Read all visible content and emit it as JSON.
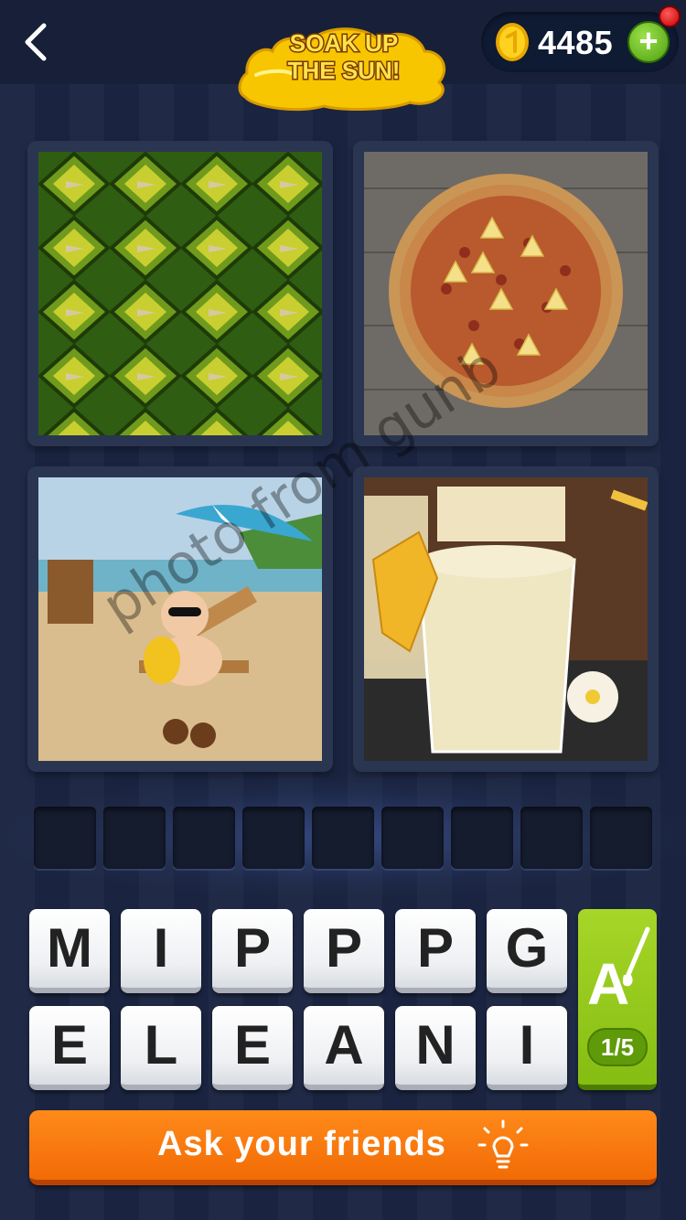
{
  "header": {
    "back_icon": "chevron-left-icon",
    "logo_text_line1": "SOAK UP",
    "logo_text_line2": "THE SUN!",
    "coins": "4485",
    "add_coins_label": "+",
    "coin_icon": "coin-icon"
  },
  "pictures": [
    {
      "subject": "pineapple skin close-up",
      "icon": "pineapple-skin-image"
    },
    {
      "subject": "pineapple pizza",
      "icon": "pizza-image"
    },
    {
      "subject": "baby on beach chair",
      "icon": "beach-baby-image"
    },
    {
      "subject": "pineapple smoothies",
      "icon": "smoothie-image"
    }
  ],
  "watermark": "photo from gunb",
  "answer_slots": [
    "",
    "",
    "",
    "",
    "",
    "",
    "",
    "",
    ""
  ],
  "keyboard": {
    "row1": [
      "M",
      "I",
      "P",
      "P",
      "P",
      "G"
    ],
    "row2": [
      "E",
      "L",
      "E",
      "A",
      "N",
      "I"
    ]
  },
  "hint": {
    "icon": "letter-brush-icon",
    "count": "1/5"
  },
  "ask_friends": {
    "label": "Ask your friends",
    "icon": "lightbulb-icon"
  },
  "colors": {
    "background": "#1b2542",
    "hint_green": "#86bd12",
    "ask_orange": "#f26b06",
    "logo_yellow": "#f7c600"
  }
}
